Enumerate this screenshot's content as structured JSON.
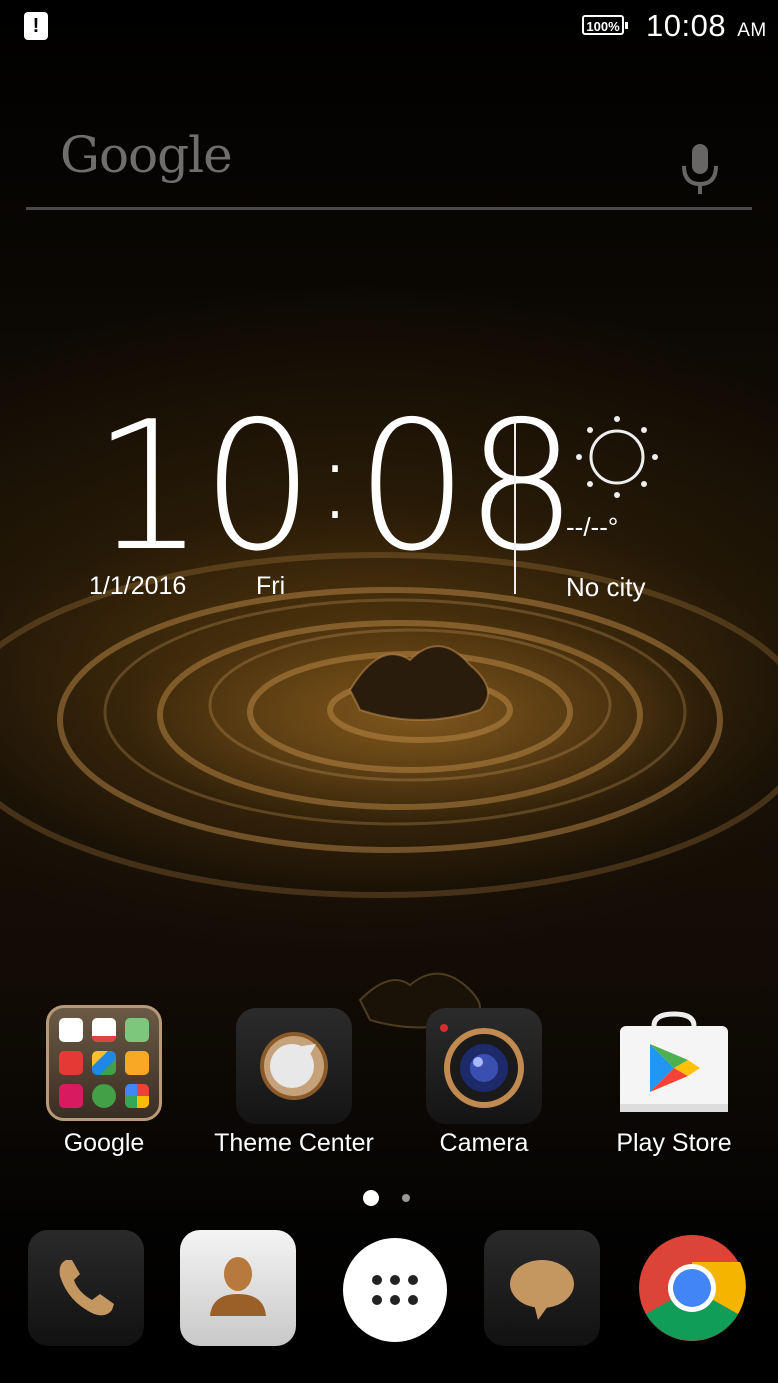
{
  "status_bar": {
    "notification_icon": "alert-icon",
    "battery": "100%",
    "time": "10:08",
    "ampm": "AM"
  },
  "search": {
    "logo": "Google",
    "mic_icon": "mic-icon"
  },
  "clock_widget": {
    "hours": "10",
    "minutes": "08",
    "date": "1/1/2016",
    "day": "Fri",
    "weather_icon": "sun-icon",
    "temperature": "--/--°",
    "city": "No city"
  },
  "apps": [
    {
      "label": "Google",
      "icon": "google-folder-icon"
    },
    {
      "label": "Theme Center",
      "icon": "theme-center-icon"
    },
    {
      "label": "Camera",
      "icon": "camera-icon"
    },
    {
      "label": "Play Store",
      "icon": "play-store-icon"
    }
  ],
  "page_indicator": {
    "pages": 2,
    "current": 1
  },
  "dock": [
    {
      "name": "phone",
      "icon": "phone-icon"
    },
    {
      "name": "contacts",
      "icon": "contacts-icon"
    },
    {
      "name": "app-drawer",
      "icon": "app-drawer-icon"
    },
    {
      "name": "messages",
      "icon": "messages-icon"
    },
    {
      "name": "chrome",
      "icon": "chrome-icon"
    }
  ],
  "colors": {
    "accent_gold": "#b8864a",
    "search_logo_gray": "#6e6e6e"
  }
}
